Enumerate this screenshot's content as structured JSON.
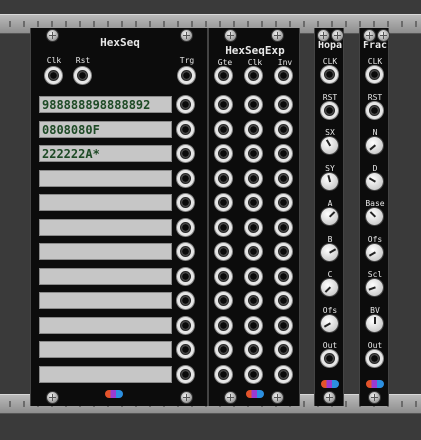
{
  "hexseq": {
    "title": "HexSeq",
    "clk_label": "Clk",
    "rst_label": "Rst",
    "trg_label": "Trg",
    "sequences": [
      "988888898888892",
      "0808080F",
      "222222A*",
      "",
      "",
      "",
      "",
      "",
      "",
      "",
      "",
      ""
    ]
  },
  "hexseqexp": {
    "title": "HexSeqExp",
    "gte_label": "Gte",
    "clk_label": "Clk",
    "inv_label": "Inv"
  },
  "hopa": {
    "title": "Hopa",
    "labels": [
      "CLK",
      "RST",
      "SX",
      "SY",
      "A",
      "B",
      "C",
      "Ofs",
      "Out"
    ]
  },
  "frac": {
    "title": "Frac",
    "labels": [
      "CLK",
      "RST",
      "N",
      "D",
      "Base",
      "Ofs",
      "Scl",
      "BV",
      "Out"
    ]
  },
  "brand": {
    "logo_icon": "dbrackets-logo-icon"
  },
  "colors": {
    "panel": "#0c0c0c",
    "display": "#c6c6c6",
    "display_text": "#1e4a26"
  }
}
